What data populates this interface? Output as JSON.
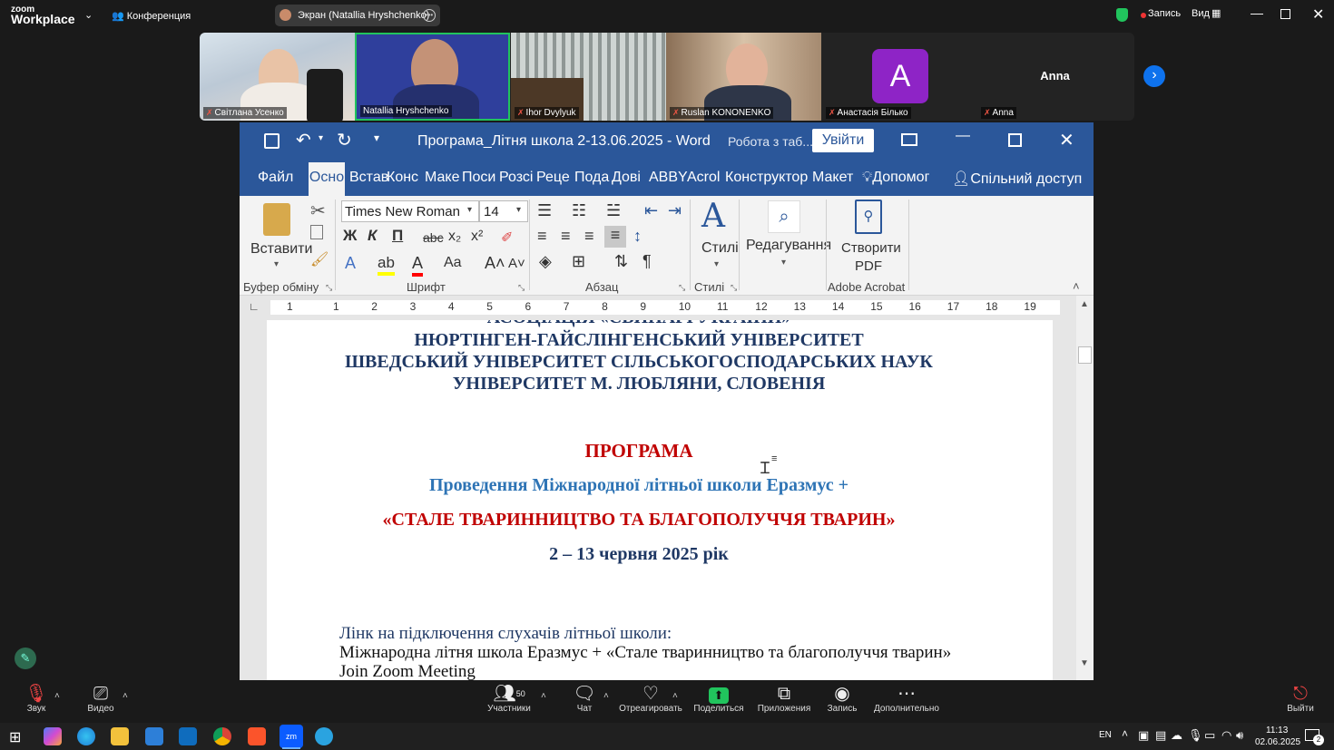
{
  "zoom": {
    "logo_line1": "zoom",
    "logo_line2": "Workplace",
    "meeting_label": "Конференция",
    "share_label": "Экран (Natallia Hryshchenko)",
    "record_label": "Запись",
    "view_label": "Вид",
    "participants": [
      {
        "name": "Світлана Усенко",
        "muted": true
      },
      {
        "name": "Natallia Hryshchenko",
        "muted": false
      },
      {
        "name": "Ihor Dvylyuk",
        "muted": true
      },
      {
        "name": "Ruslan KONONENKO",
        "muted": true
      },
      {
        "name": "Анастасія Білько",
        "muted": true,
        "avatar": "A"
      },
      {
        "name": "Anna",
        "muted": true,
        "big_name": "Anna"
      }
    ],
    "bottom": {
      "sound": "Звук",
      "video": "Видео",
      "participants": "Участники",
      "participants_count": "50",
      "chat": "Чат",
      "react": "Отреагировать",
      "share": "Поделиться",
      "apps": "Приложения",
      "record": "Запись",
      "more": "Дополнительно",
      "leave": "Выйти"
    }
  },
  "word": {
    "title": "Програма_Літня школа 2-13.06.2025  -  Word",
    "search_hint": "Робота з таб...",
    "signin": "Увійти",
    "tabs": [
      "Файл",
      "Осно",
      "Встав",
      "Конс",
      "Маке",
      "Поси",
      "Розсі",
      "Реце",
      "Пода",
      "Дові",
      "ABBY",
      "Acrol",
      "Конструктор",
      "Макет"
    ],
    "help": "Допомог",
    "share": "Спільний доступ",
    "ribbon": {
      "paste": "Вставити",
      "clipboard": "Буфер обміну",
      "font_name": "Times New Roman",
      "font_size": "14",
      "font_group": "Шрифт",
      "paragraph_group": "Абзац",
      "styles": "Стилі",
      "styles_group": "Стилі",
      "editing": "Редагування",
      "create_pdf_1": "Створити",
      "create_pdf_2": "PDF",
      "acrobat_group": "Adobe Acrobat"
    },
    "ruler_numbers": [
      "1",
      "1",
      "2",
      "3",
      "4",
      "5",
      "6",
      "7",
      "8",
      "9",
      "10",
      "11",
      "12",
      "13",
      "14",
      "15",
      "16",
      "17",
      "18",
      "19"
    ],
    "doc": {
      "line0": "АСОЦІАЦІЯ «СВИНАРІ УКРАЇНИ»",
      "line1": "НЮРТІНГЕН-ГАЙСЛІНГЕНСЬКИЙ УНІВЕРСИТЕТ",
      "line2": "ШВЕДСЬКИЙ УНІВЕРСИТЕТ СІЛЬСЬКОГОСПОДАРСЬКИХ НАУК",
      "line3": "УНІВЕРСИТЕТ М. ЛЮБЛЯНИ, СЛОВЕНІЯ",
      "program": "ПРОГРАМА",
      "subtitle": "Проведення Міжнародної літньої школи Еразмус +",
      "theme": "«СТАЛЕ ТВАРИННИЦТВО ТА БЛАГОПОЛУЧЧЯ ТВАРИН»",
      "dates": "2 – 13 червня 2025 рік",
      "link_label": "Лінк на підключення слухачів літньої школи:",
      "link_desc": "Міжнародна літня школа Еразмус + «Стале тваринництво та благополуччя тварин»",
      "join": "Join Zoom Meeting"
    }
  },
  "taskbar": {
    "lang": "EN",
    "time": "11:13",
    "date": "02.06.2025",
    "notif": "2"
  },
  "colors": {
    "word_blue": "#2b579a",
    "navy": "#1f3864",
    "red": "#c00000",
    "teal_blue": "#2e74b5",
    "zoom_green": "#21c45d"
  }
}
